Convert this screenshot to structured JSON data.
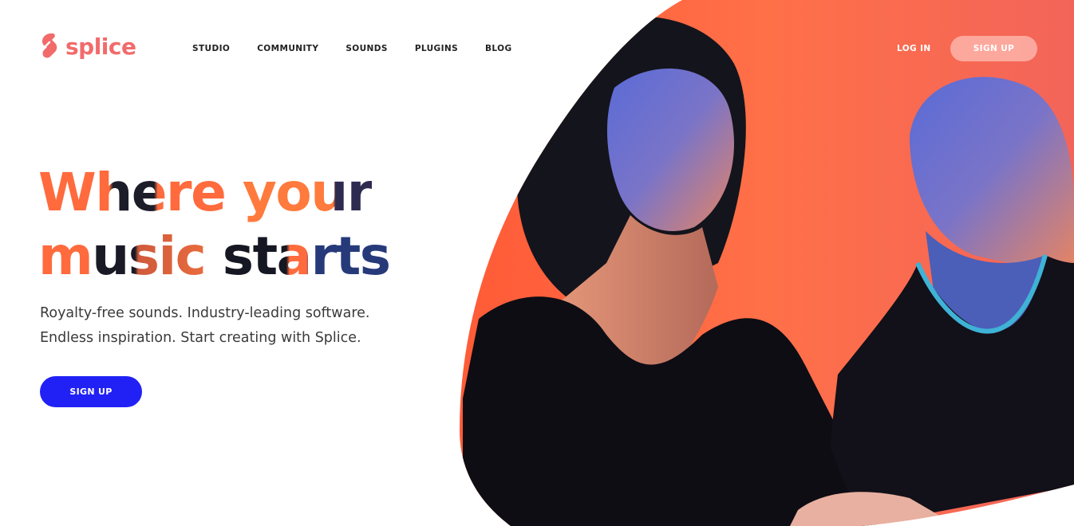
{
  "brand": {
    "name": "splice",
    "color": "#f26b6b"
  },
  "nav": {
    "items": [
      "STUDIO",
      "COMMUNITY",
      "SOUNDS",
      "PLUGINS",
      "BLOG"
    ]
  },
  "header": {
    "login_label": "LOG IN",
    "signup_label": "SIGN UP"
  },
  "hero": {
    "headline_line1": [
      "Where",
      "your"
    ],
    "headline_line2": [
      "music",
      "starts"
    ],
    "subtitle_line1": "Royalty-free sounds. Industry-leading software.",
    "subtitle_line2": "Endless inspiration. Start creating with Splice.",
    "cta_label": "SIGN UP",
    "cta_color": "#2121f5",
    "accent_color": "#ff6b3d"
  }
}
